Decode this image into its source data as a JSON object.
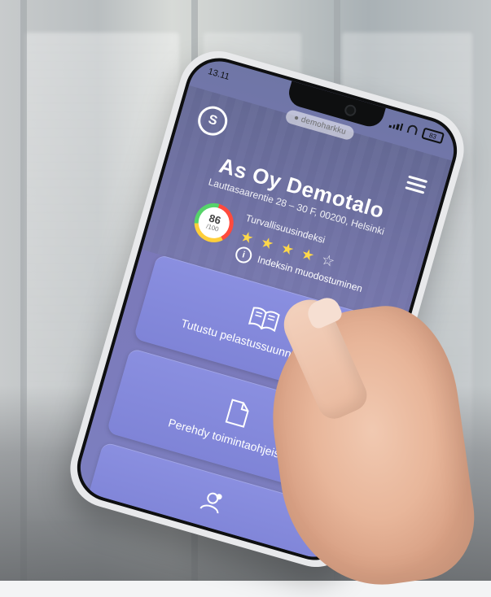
{
  "device": {
    "status": {
      "time": "13.11",
      "battery": "83"
    },
    "url": "● demoharkku"
  },
  "app": {
    "title": "As Oy Demotalo",
    "address": "Lauttasaarentie 28 – 30 F, 00200, Helsinki",
    "score": {
      "value": "86",
      "sub": "/100"
    },
    "index": {
      "label": "Turvallisuusindeksi",
      "rating": 4,
      "max": 5
    },
    "info": {
      "label": "Indeksin muodostuminen"
    },
    "cards": [
      {
        "label": "Tutustu pelastussuunnitelmaan"
      },
      {
        "label": "Perehdy toimintaohjeisiin"
      },
      {
        "label": ""
      }
    ]
  }
}
